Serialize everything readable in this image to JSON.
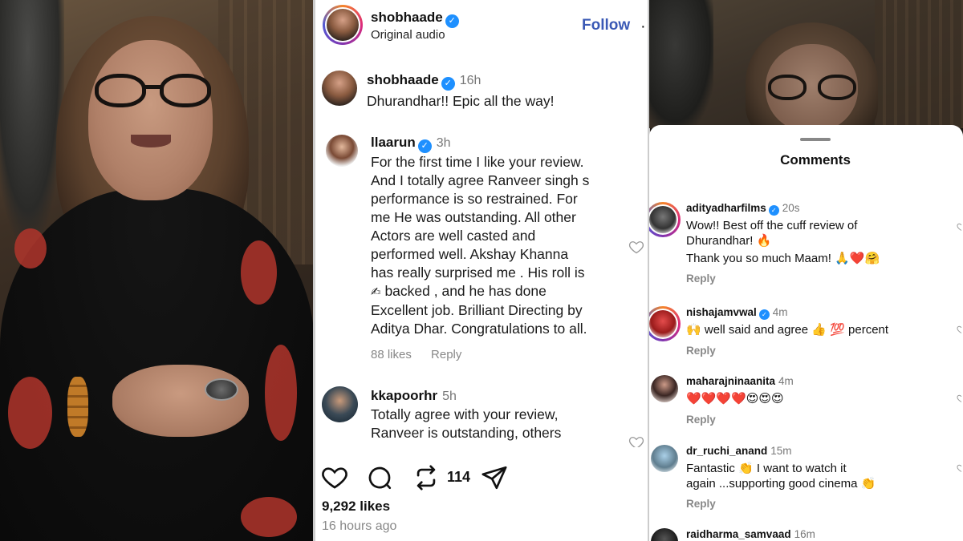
{
  "post": {
    "author": "shobhaade",
    "audio": "Original audio",
    "follow_label": "Follow",
    "more": "·",
    "likes": "9,292 likes",
    "time_ago": "16 hours ago",
    "share_count": "114"
  },
  "post_comments": [
    {
      "user": "shobhaade",
      "time": "16h",
      "lines": [
        "Dhurandhar!! Epic all the way!"
      ]
    },
    {
      "user": "llaarun",
      "time": "3h",
      "lines": [
        "For the first time I like your review.",
        "And I totally agree Ranveer singh s",
        "performance is so restrained. For",
        "me He was outstanding. All other",
        "Actors are well casted and",
        "performed well. Akshay Khanna",
        "has really surprised me . His roll is",
        "backed , and he has done",
        "Excellent job. Brilliant Directing by",
        "Aditya Dhar. Congratulations to all."
      ],
      "hand_emoji": "✍",
      "likes": "88 likes",
      "reply": "Reply"
    },
    {
      "user": "kkapoorhr",
      "time": "5h",
      "lines": [
        "Totally agree with your review,",
        "Ranveer is outstanding, others"
      ]
    }
  ],
  "comments_sheet": {
    "title": "Comments",
    "reply_label": "Reply",
    "items": [
      {
        "user": "adityadharfilms",
        "time": "20s",
        "verified": true,
        "lines": [
          "Wow!! Best off the cuff review of",
          "Dhurandhar!",
          "Thank you so much Maam!"
        ],
        "emojis": [
          "🔥",
          "🙏❤️🤗"
        ]
      },
      {
        "user": "nishajamvwal",
        "time": "4m",
        "verified": true,
        "lead_emoji": "🙌",
        "text": "well said and agree",
        "mid_emoji": "👍",
        "end_emoji": "💯",
        "tail": "percent"
      },
      {
        "user": "maharajninaanita",
        "time": "4m",
        "verified": false,
        "emojis": "❤️❤️❤️❤️😍😍😍"
      },
      {
        "user": "dr_ruchi_anand",
        "time": "15m",
        "verified": false,
        "lines": [
          "Fantastic",
          "I want to watch it",
          "again ...supporting good cinema"
        ],
        "emojis": [
          "👏",
          "👏"
        ]
      },
      {
        "user": "raidharma_samvaad",
        "time": "16m",
        "verified": false
      }
    ]
  },
  "colors": {
    "follow": "#3a59b5",
    "verified": "#1e90ff",
    "muted": "#888888"
  }
}
